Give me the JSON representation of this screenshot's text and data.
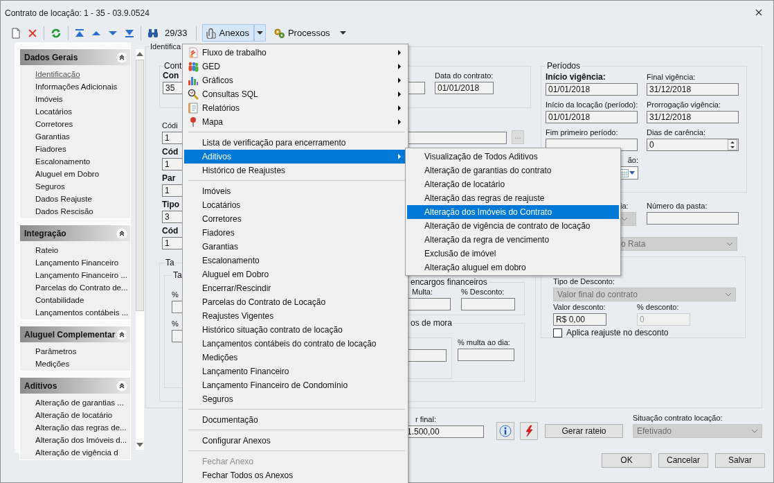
{
  "window": {
    "title": "Contrato de locação: 1 - 35 - 03.9.0524"
  },
  "toolbar": {
    "counter": "29/33",
    "attachments": {
      "label": "Anexos",
      "selected": true
    },
    "processes": {
      "label": "Processos"
    }
  },
  "sidebar": {
    "sections": [
      {
        "title": "Dados Gerais",
        "items": [
          {
            "label": "Identificação",
            "selected": true
          },
          {
            "label": "Informações Adicionais",
            "selected": false
          },
          {
            "label": "Imóveis",
            "selected": false
          },
          {
            "label": "Locatários",
            "selected": false
          },
          {
            "label": "Corretores",
            "selected": false
          },
          {
            "label": "Garantias",
            "selected": false
          },
          {
            "label": "Fiadores",
            "selected": false
          },
          {
            "label": "Escalonamento",
            "selected": false
          },
          {
            "label": "Aluguel em Dobro",
            "selected": false
          },
          {
            "label": "Seguros",
            "selected": false
          },
          {
            "label": "Dados Reajuste",
            "selected": false
          },
          {
            "label": "Dados Rescisão",
            "selected": false
          }
        ]
      },
      {
        "title": "Integração",
        "items": [
          {
            "label": "Rateio",
            "selected": false
          },
          {
            "label": "Lançamento Financeiro",
            "selected": false
          },
          {
            "label": "Lançamento Financeiro ...",
            "selected": false
          },
          {
            "label": "Parcelas do Contrato de...",
            "selected": false
          },
          {
            "label": "Contabilidade",
            "selected": false
          },
          {
            "label": "Lançamentos contábeis ...",
            "selected": false
          }
        ]
      },
      {
        "title": "Aluguel Complementar",
        "items": [
          {
            "label": "Parâmetros",
            "selected": false
          },
          {
            "label": "Medições",
            "selected": false
          }
        ]
      },
      {
        "title": "Aditivos",
        "items": [
          {
            "label": "Alteração de garantias ...",
            "selected": false
          },
          {
            "label": "Alteração de locatário",
            "selected": false
          },
          {
            "label": "Alteração das regras de...",
            "selected": false
          },
          {
            "label": "Alteração dos Imóveis d...",
            "selected": false
          },
          {
            "label": "Alteração de vigência d",
            "selected": false
          }
        ]
      }
    ]
  },
  "form": {
    "tab": "Identifica",
    "contract": {
      "legend": "Cont",
      "number_label": "Con",
      "number_value": "35",
      "date_label": "Data do contrato:",
      "date_value": "01/01/2018"
    },
    "codes": [
      {
        "label": "Códi",
        "value": "1",
        "required": false
      },
      {
        "label": "Cód",
        "value": "1",
        "required": true
      },
      {
        "label": "Par",
        "value": "1",
        "required": true
      },
      {
        "label": "Tipo",
        "value": "3",
        "required": true
      },
      {
        "label": "Cód",
        "value": "1",
        "required": true
      }
    ],
    "lookup_button": "...",
    "taxes": {
      "legend": "Ta",
      "inner_legend": "Ta",
      "percent_labels": [
        "%",
        "%"
      ],
      "charges_legend": "encargos financeiros",
      "fine_label": "Multa:",
      "discount_label": "% Desconto:",
      "late_legend": "os de mora",
      "daily_fine_label": "% multa ao dia:"
    },
    "periods": {
      "legend": "Períodos",
      "fields": [
        {
          "label": "Início vigência:",
          "value": "01/01/2018",
          "required": true,
          "kind": "text"
        },
        {
          "label": "Final vigência:",
          "value": "31/12/2018",
          "required": false,
          "kind": "text"
        },
        {
          "label": "Início da locação (período):",
          "value": "01/01/2018",
          "required": false,
          "kind": "text"
        },
        {
          "label": "Prorrogação vigência:",
          "value": "31/12/2018",
          "required": false,
          "kind": "text"
        },
        {
          "label": "Fim primeiro período:",
          "required": false,
          "kind": "text"
        },
        {
          "label": "Dias de carência:",
          "value": "0",
          "required": false,
          "kind": "spin"
        },
        {
          "label": "ão:",
          "required": false,
          "kind": "date"
        }
      ]
    },
    "category": {
      "label": "ia:",
      "disabled": true
    },
    "folder": {
      "label": "Número da pasta:"
    },
    "pro_rata": {
      "value": "o Rata",
      "disabled": true
    },
    "discount": {
      "type_label": "Tipo de Desconto:",
      "type_value": "Valor final do contrato",
      "type_disabled": true,
      "value_label": "Valor desconto:",
      "value": "R$ 0,00",
      "percent_label": "% desconto:",
      "percent": "0",
      "percent_disabled": true,
      "readjust": {
        "label": "Aplica reajuste no desconto",
        "checked": false
      }
    },
    "final_value": {
      "label": "r final:",
      "value": "1.500,00"
    },
    "apportion_button": "Gerar rateio",
    "status": {
      "label": "Situação contrato locação:",
      "value": "Efetivado",
      "disabled": true
    }
  },
  "buttons": [
    "OK",
    "Cancelar",
    "Salvar"
  ],
  "menu": {
    "items": [
      {
        "kind": "submenu",
        "label": "Fluxo de trabalho",
        "selected": false,
        "disabled": false
      },
      {
        "kind": "submenu",
        "label": "GED",
        "selected": false,
        "disabled": false
      },
      {
        "kind": "submenu",
        "label": "Gráficos",
        "selected": false,
        "disabled": false
      },
      {
        "kind": "submenu",
        "label": "Consultas SQL",
        "selected": false,
        "disabled": false
      },
      {
        "kind": "submenu",
        "label": "Relatórios",
        "selected": false,
        "disabled": false
      },
      {
        "kind": "submenu",
        "label": "Mapa",
        "selected": false,
        "disabled": false
      },
      {
        "kind": "separator"
      },
      {
        "kind": "item",
        "label": "Lista de verificação para encerramento",
        "selected": false,
        "disabled": false
      },
      {
        "kind": "submenu",
        "label": "Aditivos",
        "selected": true,
        "disabled": false
      },
      {
        "kind": "item",
        "label": "Histórico de Reajustes",
        "selected": false,
        "disabled": false
      },
      {
        "kind": "separator"
      },
      {
        "kind": "item",
        "label": "Imóveis",
        "selected": false,
        "disabled": false
      },
      {
        "kind": "item",
        "label": "Locatários",
        "selected": false,
        "disabled": false
      },
      {
        "kind": "item",
        "label": "Corretores",
        "selected": false,
        "disabled": false
      },
      {
        "kind": "item",
        "label": "Fiadores",
        "selected": false,
        "disabled": false
      },
      {
        "kind": "item",
        "label": "Garantias",
        "selected": false,
        "disabled": false
      },
      {
        "kind": "item",
        "label": "Escalonamento",
        "selected": false,
        "disabled": false
      },
      {
        "kind": "item",
        "label": "Aluguel em Dobro",
        "selected": false,
        "disabled": false
      },
      {
        "kind": "item",
        "label": "Encerrar/Rescindir",
        "selected": false,
        "disabled": false
      },
      {
        "kind": "item",
        "label": "Parcelas do Contrato de Locação",
        "selected": false,
        "disabled": false
      },
      {
        "kind": "item",
        "label": "Reajustes Vigentes",
        "selected": false,
        "disabled": false
      },
      {
        "kind": "item",
        "label": "Histórico situação contrato de locação",
        "selected": false,
        "disabled": false
      },
      {
        "kind": "item",
        "label": "Lançamentos contábeis do contrato de locação",
        "selected": false,
        "disabled": false
      },
      {
        "kind": "item",
        "label": "Medições",
        "selected": false,
        "disabled": false
      },
      {
        "kind": "item",
        "label": "Lançamento Financeiro",
        "selected": false,
        "disabled": false
      },
      {
        "kind": "item",
        "label": "Lançamento Financeiro de Condomínio",
        "selected": false,
        "disabled": false
      },
      {
        "kind": "item",
        "label": "Seguros",
        "selected": false,
        "disabled": false
      },
      {
        "kind": "separator"
      },
      {
        "kind": "item",
        "label": "Documentação",
        "selected": false,
        "disabled": false
      },
      {
        "kind": "separator"
      },
      {
        "kind": "item",
        "label": "Configurar Anexos",
        "selected": false,
        "disabled": false
      },
      {
        "kind": "separator"
      },
      {
        "kind": "item",
        "label": "Fechar Anexo",
        "selected": false,
        "disabled": true
      },
      {
        "kind": "item",
        "label": "Fechar Todos os Anexos",
        "selected": false,
        "disabled": false
      }
    ]
  },
  "submenu": {
    "items": [
      {
        "label": "Visualização de Todos Aditivos",
        "selected": false
      },
      {
        "label": "Alteração de garantias do contrato",
        "selected": false
      },
      {
        "label": "Alteração de locatário",
        "selected": false
      },
      {
        "label": "Alteração das regras de reajuste",
        "selected": false
      },
      {
        "label": "Alteração dos Imóveis do Contrato",
        "selected": true
      },
      {
        "label": "Alteração de vigência de contrato de locação",
        "selected": false
      },
      {
        "label": "Alteração da regra de vencimento",
        "selected": false
      },
      {
        "label": "Exclusão de imóvel",
        "selected": false
      },
      {
        "label": "Alteração aluguel em dobro",
        "selected": false
      }
    ]
  }
}
